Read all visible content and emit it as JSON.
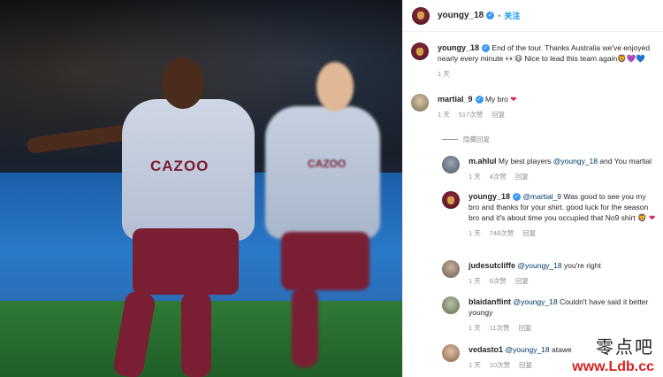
{
  "post": {
    "author": "youngy_18",
    "follow_label": "关注",
    "caption_user": "youngy_18",
    "caption_text": "End of the tour. Thanks Australia we've enjoyed nearly every minute 👀😄 Nice to lead this team again🦁💜💙",
    "caption_time": "1 天"
  },
  "photo": {
    "shirt_sponsor": "CAZOO"
  },
  "comments": [
    {
      "user": "martial_9",
      "text": "My bro",
      "time": "1 天",
      "likes": "517次赞",
      "reply": "回复",
      "hide_label": "隐藏回复"
    }
  ],
  "replies": [
    {
      "user": "m.ahlul",
      "text": "My best players",
      "mention": "@youngy_18",
      "text_after": "and You martial",
      "time": "1 天",
      "likes": "4次赞",
      "reply": "回复"
    },
    {
      "user": "youngy_18",
      "mention": "@martial_9",
      "text": "Was good to see you my bro and thanks for your shirt. good luck for the season bro and it's about time you occupied that No9 shirt 🦁",
      "time": "1 天",
      "likes": "748次赞",
      "reply": "回复"
    },
    {
      "user": "judesutcliffe",
      "mention": "@youngy_18",
      "text": "you're right",
      "time": "1 天",
      "likes": "6次赞",
      "reply": "回复"
    },
    {
      "user": "blaidanflint",
      "mention": "@youngy_18",
      "text": "Couldn't have said it better youngy",
      "time": "1 天",
      "likes": "11次赞",
      "reply": "回复"
    },
    {
      "user": "vedasto1",
      "mention": "@youngy_18",
      "text": "atawe",
      "time": "1 天",
      "likes": "10次赞",
      "reply": "回复"
    }
  ],
  "watermark": {
    "chinese": "零点吧",
    "url": "www.Ldb.cc"
  }
}
